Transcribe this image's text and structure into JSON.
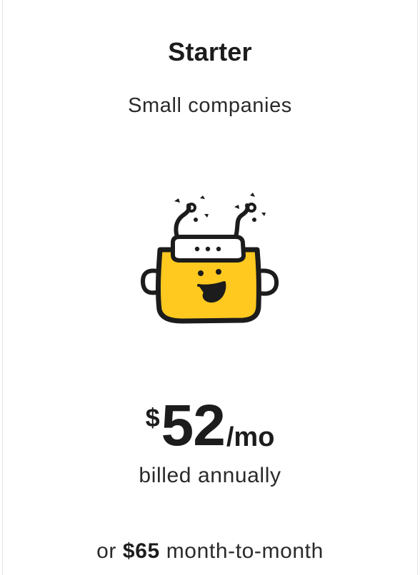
{
  "plan": {
    "name": "Starter",
    "audience": "Small companies",
    "mascot_icon": "smiling-yellow-pot-robot-icon"
  },
  "pricing": {
    "currency_symbol": "$",
    "amount": "52",
    "period": "/mo",
    "billing_note": "billed annually",
    "alt_prefix": "or",
    "alt_amount": "$65",
    "alt_suffix": "month-to-month"
  },
  "colors": {
    "accent_yellow": "#FFC91F",
    "ink": "#1c1c1c",
    "background": "#ffffff"
  }
}
